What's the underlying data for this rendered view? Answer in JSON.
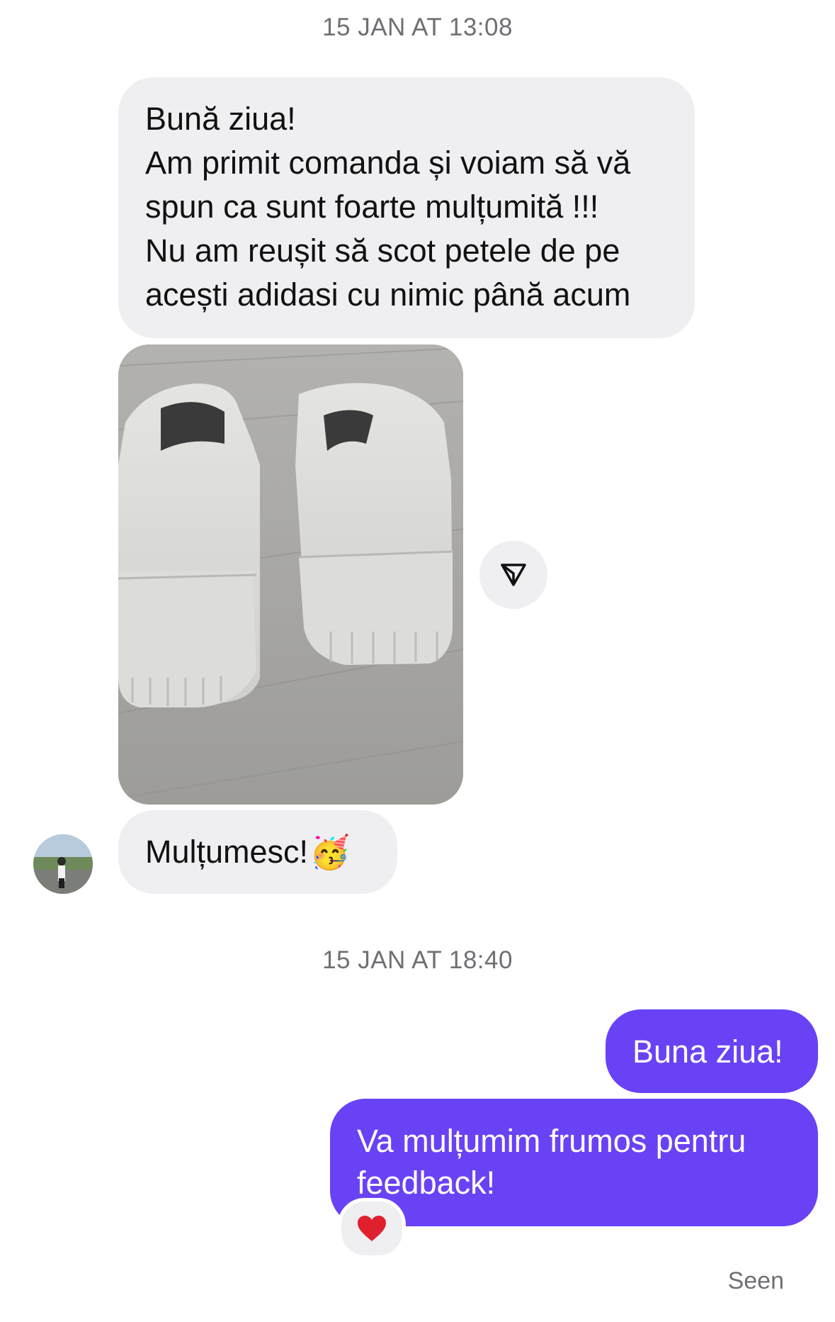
{
  "conversation": {
    "timestamp_1": "15 JAN AT 13:08",
    "timestamp_2": "15 JAN AT 18:40",
    "incoming_message_1": {
      "lines": [
        "Bună ziua!",
        "Am primit comanda și voiam să vă",
        "spun ca sunt foarte mulțumită !!!",
        "Nu am reușit să scot petele de pe",
        "acești adidasi cu nimic până acum"
      ]
    },
    "photo": {
      "description_icon": "shoes-photo"
    },
    "incoming_message_2": {
      "text": "Mulțumesc!",
      "emoji": "🥳"
    },
    "outgoing_message_1": {
      "text": "Buna ziua!"
    },
    "outgoing_message_2": {
      "lines": [
        "Va mulțumim frumos pentru",
        "feedback!"
      ]
    },
    "reaction": "❤️",
    "seen_label": "Seen"
  },
  "colors": {
    "incoming_bubble": "#efeff2",
    "outgoing_bubble": "#6a42f5",
    "timestamp_text": "#6f6f74"
  },
  "icons": {
    "share": "share-icon",
    "avatar": "avatar"
  }
}
